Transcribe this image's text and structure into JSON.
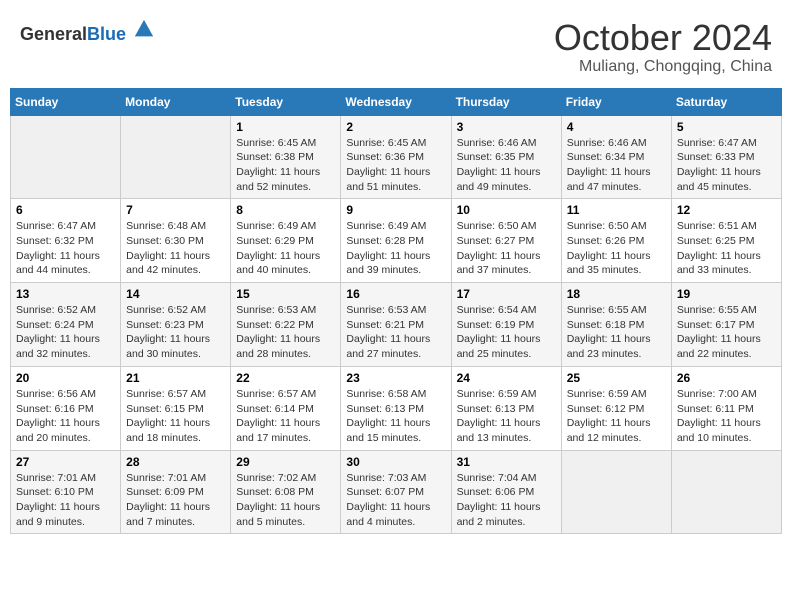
{
  "logo": {
    "general": "General",
    "blue": "Blue"
  },
  "header": {
    "month": "October 2024",
    "location": "Muliang, Chongqing, China"
  },
  "weekdays": [
    "Sunday",
    "Monday",
    "Tuesday",
    "Wednesday",
    "Thursday",
    "Friday",
    "Saturday"
  ],
  "weeks": [
    [
      {
        "day": "",
        "info": ""
      },
      {
        "day": "",
        "info": ""
      },
      {
        "day": "1",
        "info": "Sunrise: 6:45 AM\nSunset: 6:38 PM\nDaylight: 11 hours and 52 minutes."
      },
      {
        "day": "2",
        "info": "Sunrise: 6:45 AM\nSunset: 6:36 PM\nDaylight: 11 hours and 51 minutes."
      },
      {
        "day": "3",
        "info": "Sunrise: 6:46 AM\nSunset: 6:35 PM\nDaylight: 11 hours and 49 minutes."
      },
      {
        "day": "4",
        "info": "Sunrise: 6:46 AM\nSunset: 6:34 PM\nDaylight: 11 hours and 47 minutes."
      },
      {
        "day": "5",
        "info": "Sunrise: 6:47 AM\nSunset: 6:33 PM\nDaylight: 11 hours and 45 minutes."
      }
    ],
    [
      {
        "day": "6",
        "info": "Sunrise: 6:47 AM\nSunset: 6:32 PM\nDaylight: 11 hours and 44 minutes."
      },
      {
        "day": "7",
        "info": "Sunrise: 6:48 AM\nSunset: 6:30 PM\nDaylight: 11 hours and 42 minutes."
      },
      {
        "day": "8",
        "info": "Sunrise: 6:49 AM\nSunset: 6:29 PM\nDaylight: 11 hours and 40 minutes."
      },
      {
        "day": "9",
        "info": "Sunrise: 6:49 AM\nSunset: 6:28 PM\nDaylight: 11 hours and 39 minutes."
      },
      {
        "day": "10",
        "info": "Sunrise: 6:50 AM\nSunset: 6:27 PM\nDaylight: 11 hours and 37 minutes."
      },
      {
        "day": "11",
        "info": "Sunrise: 6:50 AM\nSunset: 6:26 PM\nDaylight: 11 hours and 35 minutes."
      },
      {
        "day": "12",
        "info": "Sunrise: 6:51 AM\nSunset: 6:25 PM\nDaylight: 11 hours and 33 minutes."
      }
    ],
    [
      {
        "day": "13",
        "info": "Sunrise: 6:52 AM\nSunset: 6:24 PM\nDaylight: 11 hours and 32 minutes."
      },
      {
        "day": "14",
        "info": "Sunrise: 6:52 AM\nSunset: 6:23 PM\nDaylight: 11 hours and 30 minutes."
      },
      {
        "day": "15",
        "info": "Sunrise: 6:53 AM\nSunset: 6:22 PM\nDaylight: 11 hours and 28 minutes."
      },
      {
        "day": "16",
        "info": "Sunrise: 6:53 AM\nSunset: 6:21 PM\nDaylight: 11 hours and 27 minutes."
      },
      {
        "day": "17",
        "info": "Sunrise: 6:54 AM\nSunset: 6:19 PM\nDaylight: 11 hours and 25 minutes."
      },
      {
        "day": "18",
        "info": "Sunrise: 6:55 AM\nSunset: 6:18 PM\nDaylight: 11 hours and 23 minutes."
      },
      {
        "day": "19",
        "info": "Sunrise: 6:55 AM\nSunset: 6:17 PM\nDaylight: 11 hours and 22 minutes."
      }
    ],
    [
      {
        "day": "20",
        "info": "Sunrise: 6:56 AM\nSunset: 6:16 PM\nDaylight: 11 hours and 20 minutes."
      },
      {
        "day": "21",
        "info": "Sunrise: 6:57 AM\nSunset: 6:15 PM\nDaylight: 11 hours and 18 minutes."
      },
      {
        "day": "22",
        "info": "Sunrise: 6:57 AM\nSunset: 6:14 PM\nDaylight: 11 hours and 17 minutes."
      },
      {
        "day": "23",
        "info": "Sunrise: 6:58 AM\nSunset: 6:13 PM\nDaylight: 11 hours and 15 minutes."
      },
      {
        "day": "24",
        "info": "Sunrise: 6:59 AM\nSunset: 6:13 PM\nDaylight: 11 hours and 13 minutes."
      },
      {
        "day": "25",
        "info": "Sunrise: 6:59 AM\nSunset: 6:12 PM\nDaylight: 11 hours and 12 minutes."
      },
      {
        "day": "26",
        "info": "Sunrise: 7:00 AM\nSunset: 6:11 PM\nDaylight: 11 hours and 10 minutes."
      }
    ],
    [
      {
        "day": "27",
        "info": "Sunrise: 7:01 AM\nSunset: 6:10 PM\nDaylight: 11 hours and 9 minutes."
      },
      {
        "day": "28",
        "info": "Sunrise: 7:01 AM\nSunset: 6:09 PM\nDaylight: 11 hours and 7 minutes."
      },
      {
        "day": "29",
        "info": "Sunrise: 7:02 AM\nSunset: 6:08 PM\nDaylight: 11 hours and 5 minutes."
      },
      {
        "day": "30",
        "info": "Sunrise: 7:03 AM\nSunset: 6:07 PM\nDaylight: 11 hours and 4 minutes."
      },
      {
        "day": "31",
        "info": "Sunrise: 7:04 AM\nSunset: 6:06 PM\nDaylight: 11 hours and 2 minutes."
      },
      {
        "day": "",
        "info": ""
      },
      {
        "day": "",
        "info": ""
      }
    ]
  ]
}
